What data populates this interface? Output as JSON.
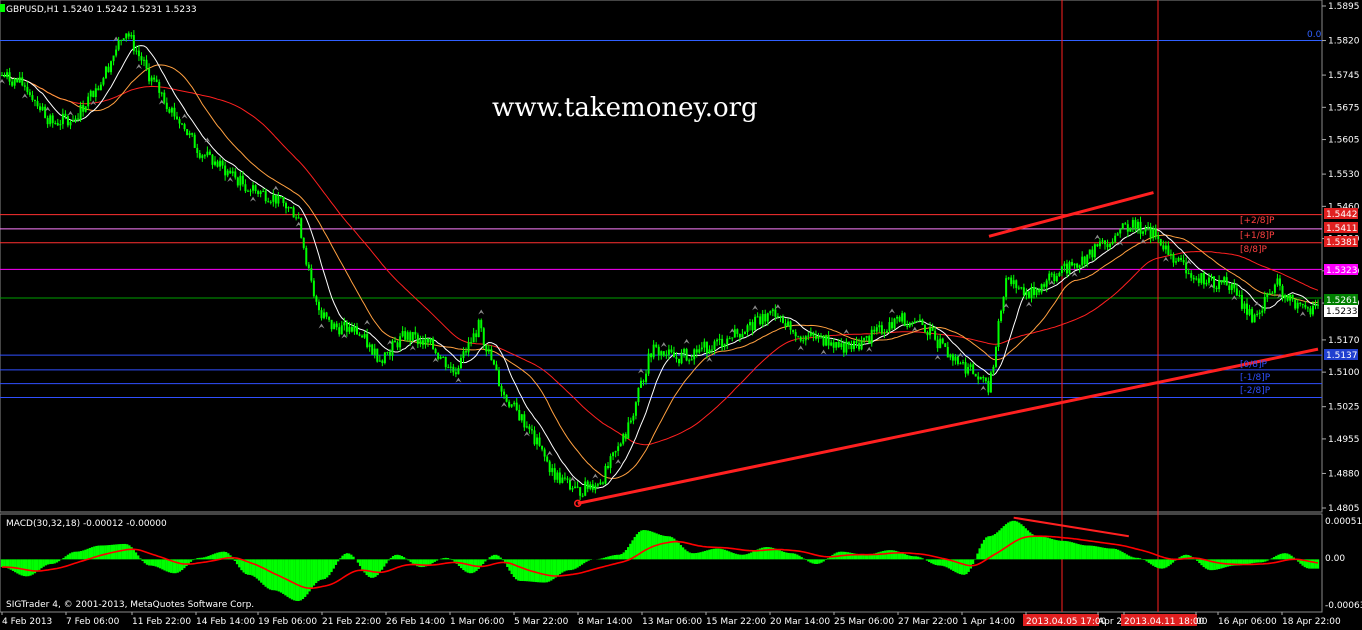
{
  "window": {
    "symbol_line": "GBPUSD,H1  1.5240 1.5242 1.5231 1.5233",
    "watermark": "www.takemoney.org",
    "copyright": "SIGTrader 4, © 2001-2013, MetaQuotes Software Corp."
  },
  "colors": {
    "background": "#000000",
    "candles": "#00ff00",
    "axis_text": "#ffffff",
    "ma_red": "#ff2020",
    "ma_orange": "#ffa040",
    "ma_white": "#ffffff",
    "trendline": "#ff2020",
    "macd_hist": "#00ff00",
    "macd_signal": "#ff0000"
  },
  "chart_data": [
    {
      "type": "candlestick",
      "title": "GBPUSD,H1  1.5240 1.5242 1.5231 1.5233",
      "ylim": [
        1.4805,
        1.5895
      ],
      "y_ticks": [
        "1.5895",
        "1.5820",
        "1.5745",
        "1.5675",
        "1.5605",
        "1.5530",
        "1.5460",
        "1.5390",
        "1.5320",
        "1.5250",
        "1.5170",
        "1.5100",
        "1.5025",
        "1.4955",
        "1.4880",
        "1.4805"
      ],
      "x_ticks": [
        "4 Feb 2013",
        "7 Feb 06:00",
        "11 Feb 22:00",
        "14 Feb 14:00",
        "19 Feb 06:00",
        "21 Feb 22:00",
        "26 Feb 14:00",
        "1 Mar 06:00",
        "5 Mar 22:00",
        "8 Mar 14:00",
        "13 Mar 06:00",
        "15 Mar 22:00",
        "20 Mar 14:00",
        "25 Mar 06:00",
        "27 Mar 22:00",
        "1 Apr 14:00",
        "2013.04.05 17:00",
        "Apr 2",
        "2013.04.11 18:00",
        "00",
        "16 Apr 06:00",
        "18 Apr 22:00"
      ],
      "close_path": [
        [
          0,
          1.5745
        ],
        [
          3,
          1.572
        ],
        [
          6,
          1.564
        ],
        [
          9,
          1.5655
        ],
        [
          12,
          1.573
        ],
        [
          15,
          1.5845
        ],
        [
          18,
          1.574
        ],
        [
          21,
          1.566
        ],
        [
          24,
          1.558
        ],
        [
          27,
          1.554
        ],
        [
          30,
          1.55
        ],
        [
          33,
          1.548
        ],
        [
          36,
          1.544
        ],
        [
          38,
          1.525
        ],
        [
          40,
          1.52
        ],
        [
          43,
          1.519
        ],
        [
          46,
          1.513
        ],
        [
          49,
          1.518
        ],
        [
          52,
          1.516
        ],
        [
          55,
          1.51
        ],
        [
          58,
          1.52
        ],
        [
          61,
          1.505
        ],
        [
          64,
          1.498
        ],
        [
          67,
          1.488
        ],
        [
          70,
          1.484
        ],
        [
          73,
          1.487
        ],
        [
          76,
          1.497
        ],
        [
          79,
          1.515
        ],
        [
          82,
          1.513
        ],
        [
          85,
          1.515
        ],
        [
          88,
          1.517
        ],
        [
          91,
          1.52
        ],
        [
          94,
          1.523
        ],
        [
          97,
          1.518
        ],
        [
          100,
          1.517
        ],
        [
          103,
          1.515
        ],
        [
          106,
          1.518
        ],
        [
          109,
          1.522
        ],
        [
          112,
          1.52
        ],
        [
          115,
          1.514
        ],
        [
          118,
          1.51
        ],
        [
          120,
          1.506
        ],
        [
          122,
          1.53
        ],
        [
          125,
          1.527
        ],
        [
          128,
          1.531
        ],
        [
          131,
          1.534
        ],
        [
          134,
          1.538
        ],
        [
          137,
          1.542
        ],
        [
          140,
          1.54
        ],
        [
          143,
          1.534
        ],
        [
          146,
          1.53
        ],
        [
          149,
          1.529
        ],
        [
          152,
          1.522
        ],
        [
          155,
          1.529
        ],
        [
          158,
          1.5233
        ]
      ],
      "levels": [
        {
          "value": 1.582,
          "label": "0.0",
          "color": "#3060ff"
        },
        {
          "value": 1.5442,
          "label": "[+2/8]P",
          "color": "#ff3030",
          "price": "1.5442"
        },
        {
          "value": 1.5411,
          "label": "[+1/8]P",
          "color": "#ff80ff",
          "price": "1.5411"
        },
        {
          "value": 1.5381,
          "label": "[8/8]P",
          "color": "#ff3030",
          "price": "1.5381"
        },
        {
          "value": 1.5323,
          "label": "",
          "color": "#ff00ff",
          "price": "1.5323"
        },
        {
          "value": 1.5261,
          "label": "",
          "color": "#00a000",
          "price": "1.5261"
        },
        {
          "value": 1.5233,
          "label": "",
          "color": "#ffffff",
          "price": "1.5233"
        },
        {
          "value": 1.5137,
          "label": "",
          "color": "#3050ff",
          "price": "1.5137"
        },
        {
          "value": 1.5105,
          "label": "[0/8]P",
          "color": "#3050ff"
        },
        {
          "value": 1.5075,
          "label": "[-1/8]P",
          "color": "#3050ff"
        },
        {
          "value": 1.5045,
          "label": "[-2/8]P",
          "color": "#3050ff"
        }
      ],
      "trendlines": [
        {
          "from": [
            70,
            1.4815
          ],
          "to": [
            160,
            1.515
          ]
        },
        {
          "from": [
            120,
            1.5395
          ],
          "to": [
            140,
            1.549
          ]
        }
      ]
    },
    {
      "type": "histogram",
      "title": "MACD(30,32,18) -0.00012 -0.00000",
      "ylim": [
        -0.0063,
        0.0051
      ],
      "y_ticks": [
        "0.00051",
        "0.00",
        "-0.00063"
      ],
      "hist": [
        [
          0,
          -0.001
        ],
        [
          3,
          -0.0022
        ],
        [
          6,
          -0.0006
        ],
        [
          9,
          0.001
        ],
        [
          12,
          0.0018
        ],
        [
          15,
          0.002
        ],
        [
          18,
          -0.0008
        ],
        [
          21,
          -0.0018
        ],
        [
          24,
          0.0002
        ],
        [
          27,
          0.001
        ],
        [
          30,
          -0.002
        ],
        [
          33,
          -0.004
        ],
        [
          36,
          -0.0054
        ],
        [
          39,
          -0.0026
        ],
        [
          42,
          0.0008
        ],
        [
          45,
          -0.0024
        ],
        [
          48,
          0.0006
        ],
        [
          51,
          -0.001
        ],
        [
          54,
          0.0002
        ],
        [
          57,
          -0.0018
        ],
        [
          60,
          0.0006
        ],
        [
          63,
          -0.0028
        ],
        [
          66,
          -0.003
        ],
        [
          69,
          -0.0014
        ],
        [
          72,
          0.0
        ],
        [
          75,
          0.0006
        ],
        [
          78,
          0.0038
        ],
        [
          81,
          0.003
        ],
        [
          84,
          0.0008
        ],
        [
          87,
          0.0014
        ],
        [
          90,
          0.0006
        ],
        [
          93,
          0.0016
        ],
        [
          96,
          0.0008
        ],
        [
          99,
          -0.0006
        ],
        [
          102,
          0.001
        ],
        [
          105,
          0.0006
        ],
        [
          108,
          0.0012
        ],
        [
          111,
          0.0004
        ],
        [
          114,
          -0.0008
        ],
        [
          117,
          -0.002
        ],
        [
          120,
          0.003
        ],
        [
          123,
          0.005
        ],
        [
          126,
          0.003
        ],
        [
          129,
          0.0024
        ],
        [
          132,
          0.0018
        ],
        [
          135,
          0.0014
        ],
        [
          138,
          0.0002
        ],
        [
          141,
          -0.0012
        ],
        [
          144,
          0.0006
        ],
        [
          147,
          -0.0014
        ],
        [
          150,
          -0.0008
        ],
        [
          153,
          -0.0004
        ],
        [
          156,
          0.0008
        ],
        [
          159,
          -0.0012
        ]
      ],
      "divergence_line": {
        "from": [
          123,
          0.0054
        ],
        "to": [
          137,
          0.003
        ]
      }
    }
  ],
  "price_tags": {
    "p1": "1.5442",
    "p2": "1.5411",
    "p3": "1.5381",
    "p4": "1.5323",
    "p5": "1.5261",
    "p6": "1.5233",
    "p7": "1.5137"
  },
  "level_labels": {
    "l1": "0.0",
    "l2": "[+2/8]P",
    "l3": "[+1/8]P",
    "l4": "[8/8]P",
    "l5": "[0/8]P",
    "l6": "[-1/8]P",
    "l7": "[-2/8]P"
  },
  "macd_title": "MACD(30,32,18) -0.00012 -0.00000",
  "macd_ticks": {
    "top": "0.00051",
    "zero": "0.00",
    "bottom": "-0.00063"
  },
  "price_ticks": [
    "1.5895",
    "1.5820",
    "1.5745",
    "1.5675",
    "1.5605",
    "1.5530",
    "1.5460",
    "1.5390",
    "1.5320",
    "1.5250",
    "1.5170",
    "1.5100",
    "1.5025",
    "1.4955",
    "1.4880",
    "1.4805"
  ],
  "time_ticks": [
    "4 Feb 2013",
    "7 Feb 06:00",
    "11 Feb 22:00",
    "14 Feb 14:00",
    "19 Feb 06:00",
    "21 Feb 22:00",
    "26 Feb 14:00",
    "1 Mar 06:00",
    "5 Mar 22:00",
    "8 Mar 14:00",
    "13 Mar 06:00",
    "15 Mar 22:00",
    "20 Mar 14:00",
    "25 Mar 06:00",
    "27 Mar 22:00",
    "1 Apr 14:00",
    "2013.04.05 17:00",
    "Apr 2",
    "2013.04.11 18:00",
    "00",
    "16 Apr 06:00",
    "18 Apr 22:00"
  ]
}
